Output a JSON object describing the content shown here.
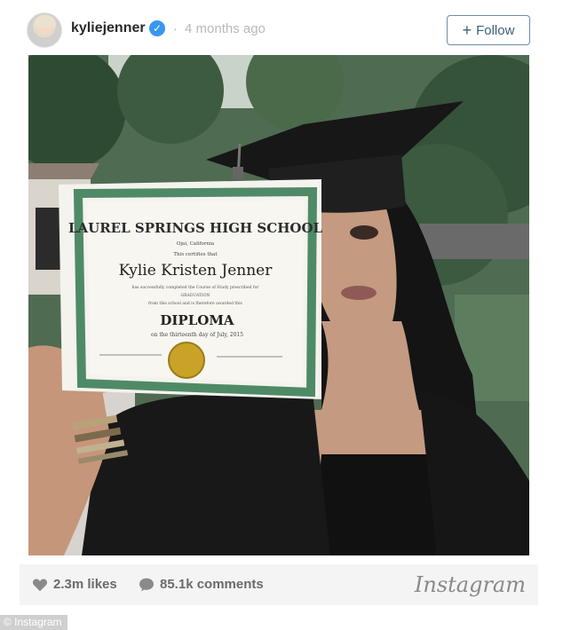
{
  "header": {
    "username": "kyliejenner",
    "separator": "·",
    "timestamp": "4 months ago",
    "follow_label": "Follow",
    "verified_glyph": "✓"
  },
  "photo": {
    "diploma": {
      "school": "LAUREL SPRINGS HIGH SCHOOL",
      "location": "Ojai, California",
      "certifies": "This certifies that",
      "name": "Kylie Kristen Jenner",
      "line1": "has successfully completed the Course of Study prescribed for",
      "line2": "GRADUATION",
      "line3": "from this school and is therefore awarded this",
      "award": "DIPLOMA",
      "date": "on the thirteenth day of July, 2015"
    }
  },
  "footer": {
    "likes": "2.3m likes",
    "comments": "85.1k comments",
    "brand": "Instagram"
  },
  "credit": "© Instagram",
  "colors": {
    "verified": "#3897f0",
    "follow_border": "#6d8fa5",
    "diploma_border": "#4f8a66",
    "seal": "#c9a227"
  },
  "icons": [
    "verified-icon",
    "plus-icon",
    "heart-icon",
    "comment-icon"
  ]
}
